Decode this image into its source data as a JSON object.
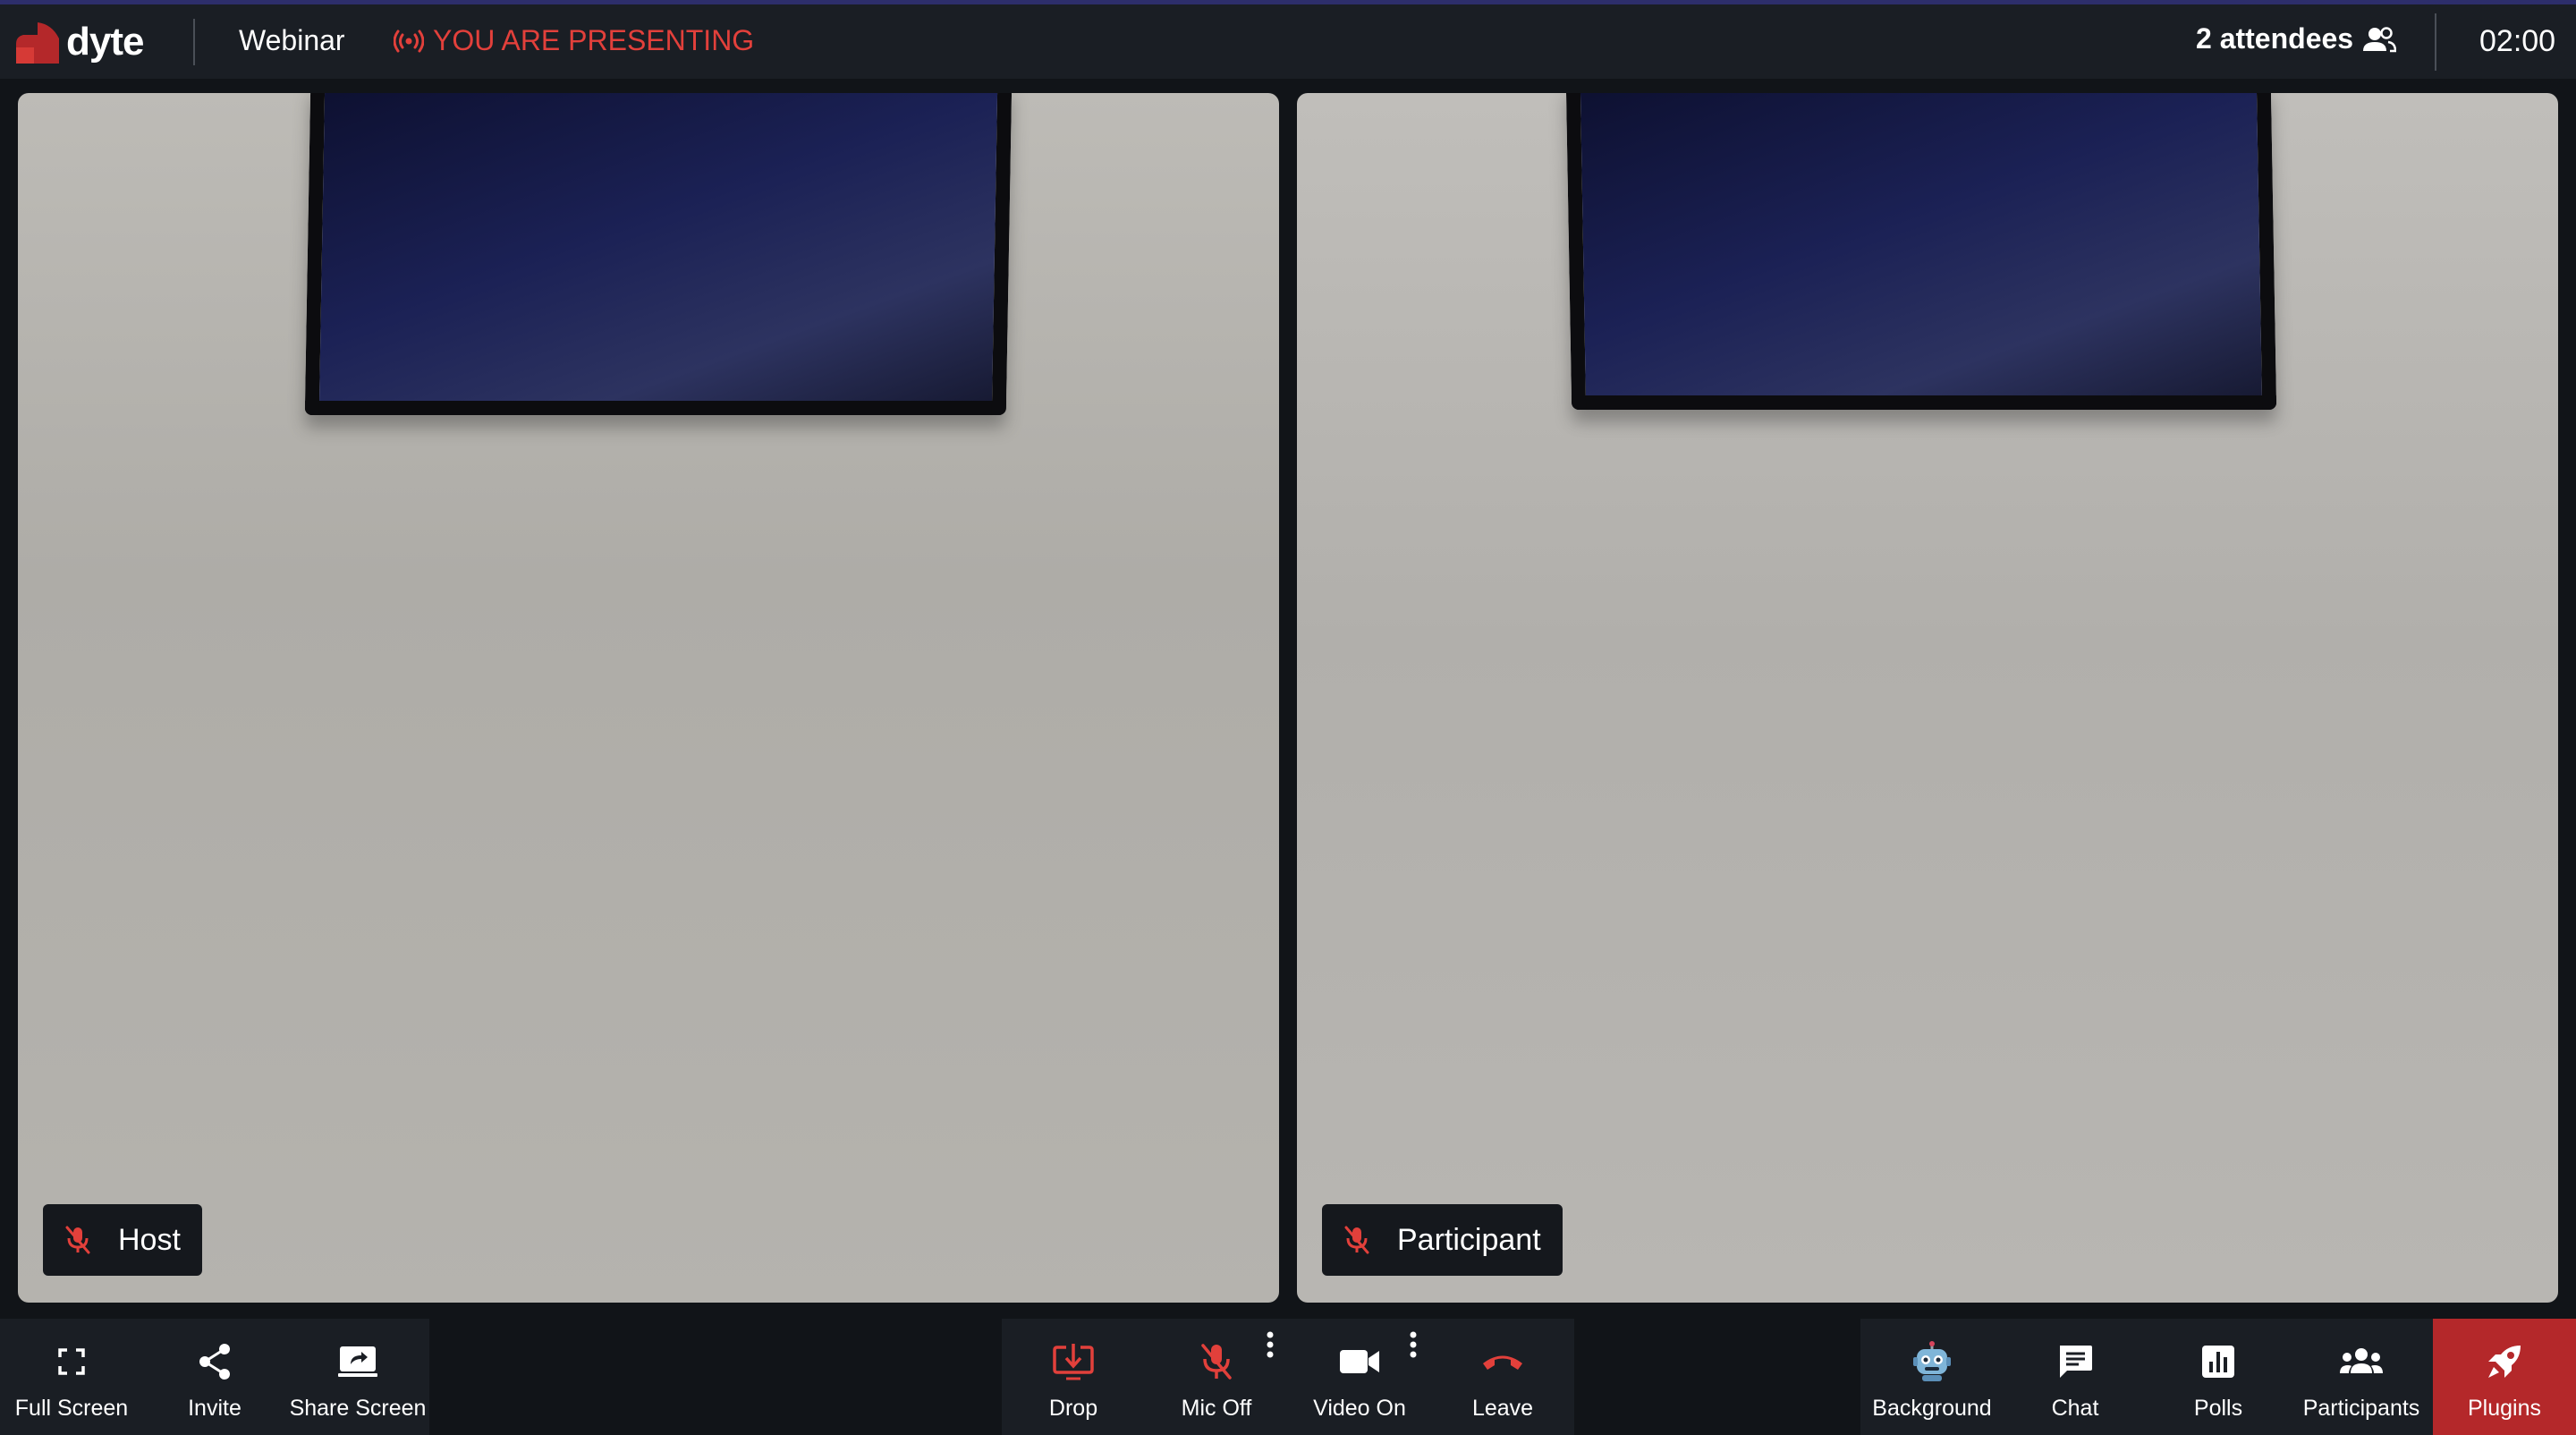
{
  "header": {
    "logo_text": "dyte",
    "meeting_title": "Webinar",
    "presenting_status": "YOU ARE PRESENTING",
    "attendees": "2 attendees",
    "timer": "02:00"
  },
  "participants": [
    {
      "name": "Host",
      "mic": "off"
    },
    {
      "name": "Participant",
      "mic": "off"
    }
  ],
  "controls": {
    "left": [
      {
        "label": "Full Screen",
        "icon": "fullscreen-icon"
      },
      {
        "label": "Invite",
        "icon": "share-icon"
      },
      {
        "label": "Share Screen",
        "icon": "screen-share-icon"
      }
    ],
    "center": [
      {
        "label": "Drop",
        "icon": "drop-icon"
      },
      {
        "label": "Mic Off",
        "icon": "mic-off-icon"
      },
      {
        "label": "Video On",
        "icon": "video-camera-icon"
      },
      {
        "label": "Leave",
        "icon": "phone-hangup-icon"
      }
    ],
    "right": [
      {
        "label": "Background",
        "icon": "robot-icon"
      },
      {
        "label": "Chat",
        "icon": "chat-icon"
      },
      {
        "label": "Polls",
        "icon": "poll-icon"
      },
      {
        "label": "Participants",
        "icon": "people-icon"
      },
      {
        "label": "Plugins",
        "icon": "rocket-icon"
      }
    ]
  },
  "colors": {
    "accent_red": "#e2403b",
    "plugins_bg": "#b4282a",
    "header_bg": "#1a1e24",
    "top_accent": "#2d2e6b"
  }
}
